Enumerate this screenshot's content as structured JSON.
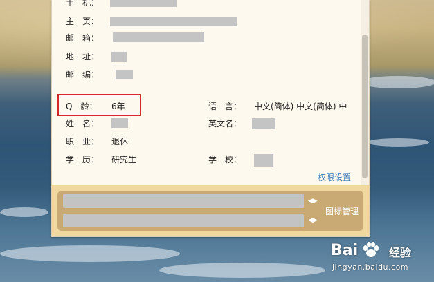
{
  "profile": {
    "phone_label": "手　机：",
    "homepage_label": "主　页：",
    "email_label": "邮　箱：",
    "address_label": "地　址：",
    "zip_label": "邮　编：",
    "qage_label": "Q　龄：",
    "qage_value": "6年",
    "language_label": "语　言：",
    "language_value": "中文(简体)  中文(简体)  中",
    "name_label": "姓　名：",
    "english_name_label": "英文名：",
    "job_label": "职　业：",
    "job_value": "退休",
    "education_label": "学　历：",
    "education_value": "研究生",
    "school_label": "学　校：",
    "permission_link": "权限设置"
  },
  "footer": {
    "icons_manage": "图标管理"
  },
  "watermark": {
    "brand": "Bai",
    "brand_cn": "经验",
    "url": "jingyan.baidu.com"
  },
  "colors": {
    "highlight": "#d9262a",
    "link": "#3a7ab8",
    "panel_bg": "#fdf9ee",
    "footer_bg": "#f0d89e"
  }
}
